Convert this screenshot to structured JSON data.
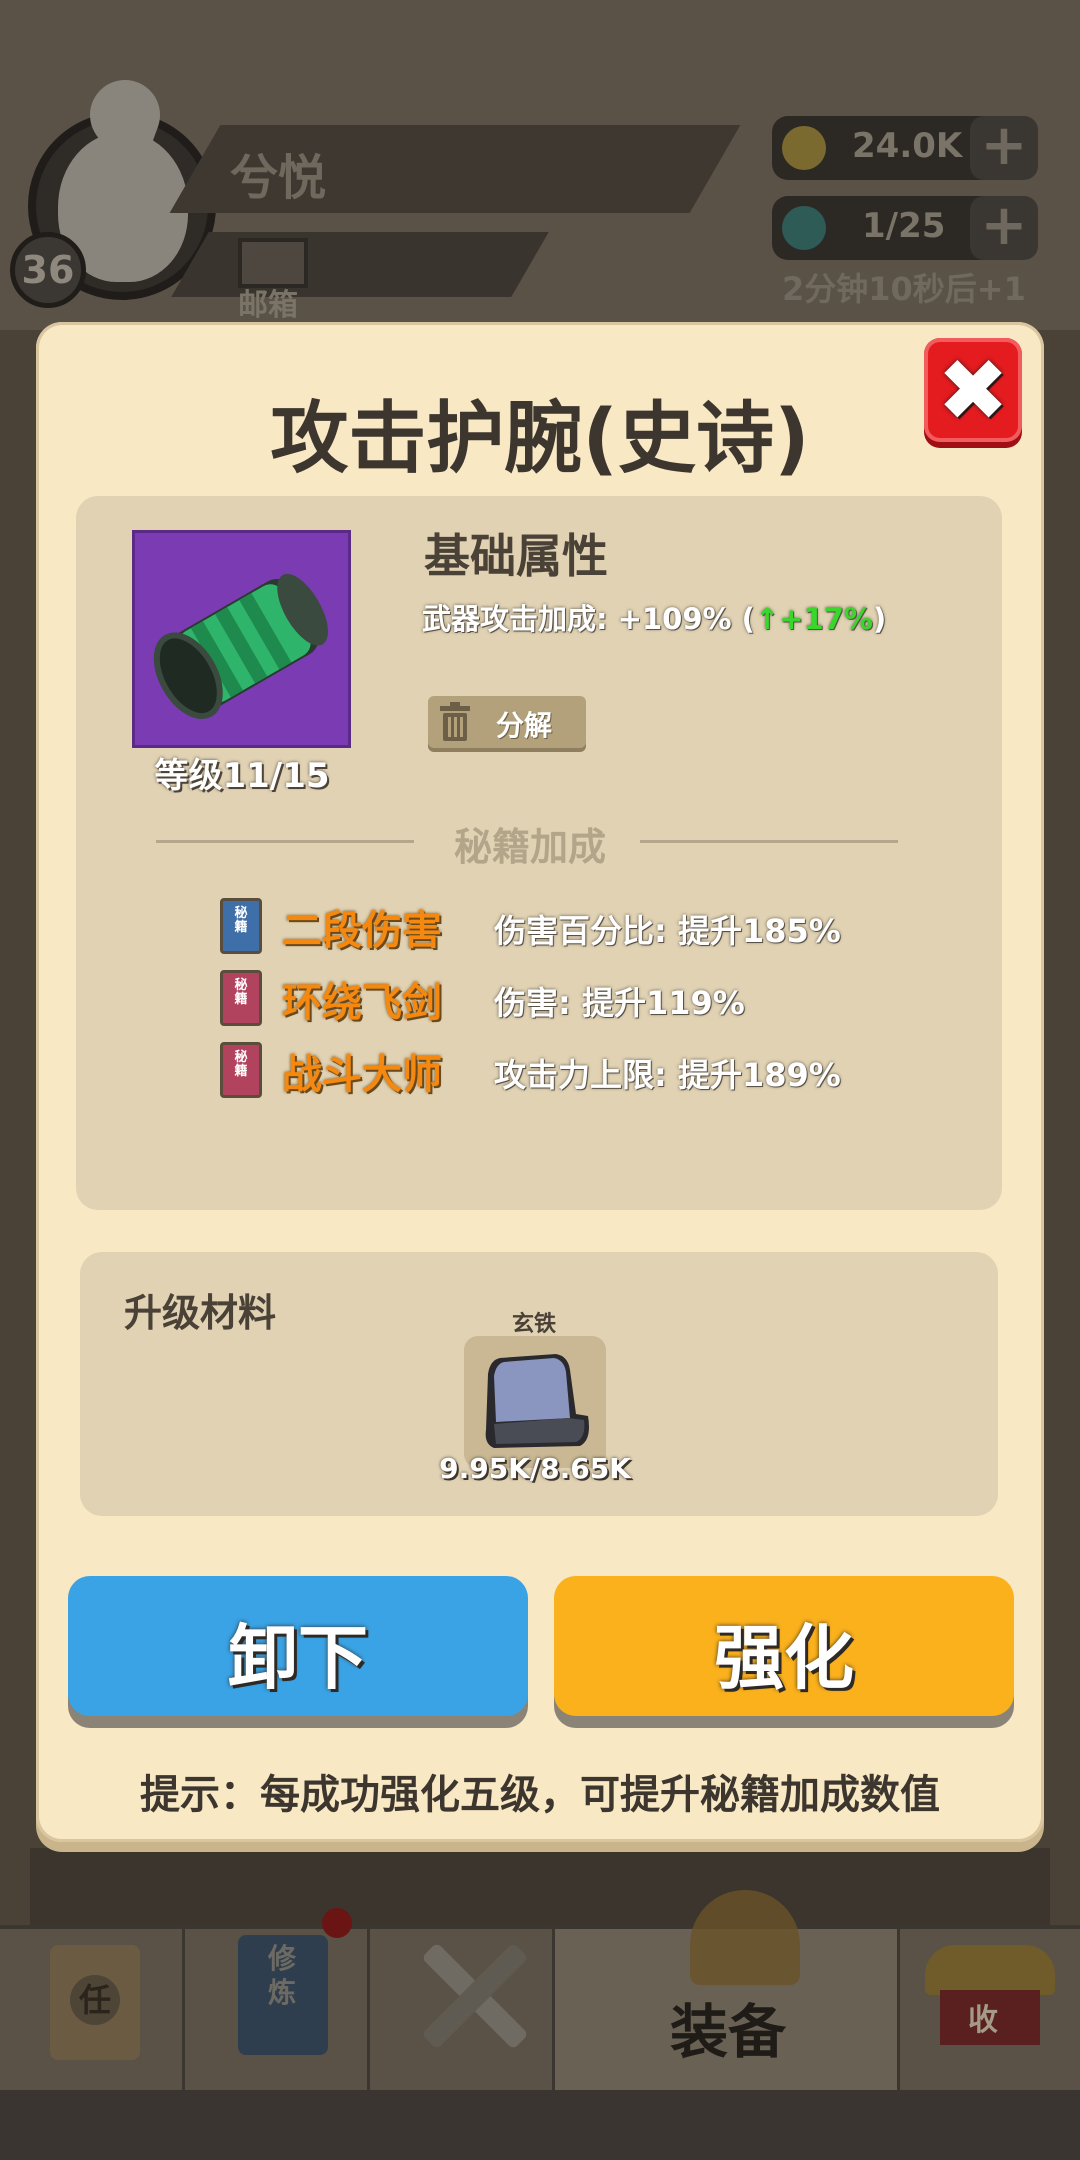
{
  "header": {
    "player_level": "36",
    "player_name": "兮悦",
    "mail_label": "邮箱",
    "coins": "24.0K",
    "stamina": "1/25",
    "stamina_timer": "2分钟10秒后+1"
  },
  "nav": {
    "task_char": "任",
    "cultivate_chars": "修炼",
    "equip_label": "装备",
    "collect_char": "收"
  },
  "modal": {
    "title": "攻击护腕(史诗)",
    "item_level": "等级11/15",
    "base_attr_title": "基础属性",
    "base_stat_prefix": "武器攻击加成: +109% (",
    "base_stat_up": "↑+17%",
    "base_stat_suffix": ")",
    "decompose_label": "分解",
    "secret_title": "秘籍加成",
    "book_char": "秘籍",
    "skills": [
      {
        "name": "二段伤害",
        "desc": "伤害百分比: 提升185%",
        "book_color": "#3f6fa8"
      },
      {
        "name": "环绕飞剑",
        "desc": "伤害: 提升119%",
        "book_color": "#b2435e"
      },
      {
        "name": "战斗大师",
        "desc": "攻击力上限: 提升189%",
        "book_color": "#b2435e"
      }
    ],
    "material_title": "升级材料",
    "material_name": "玄铁",
    "material_count": "9.95K/8.65K",
    "unequip_label": "卸下",
    "enhance_label": "强化",
    "tip": "提示：每成功强化五级，可提升秘籍加成数值"
  },
  "colors": {
    "accent_red": "#e41b1f",
    "button_blue": "#3aa3e5",
    "button_orange": "#fbb11c",
    "epic_purple": "#7b3bb3",
    "stat_up_green": "#39d62b",
    "skill_orange": "#f5880e"
  },
  "icons": {
    "close": "close-icon",
    "decompose": "trash-icon",
    "item": "bracer-icon",
    "material": "iron-ore-icon"
  }
}
